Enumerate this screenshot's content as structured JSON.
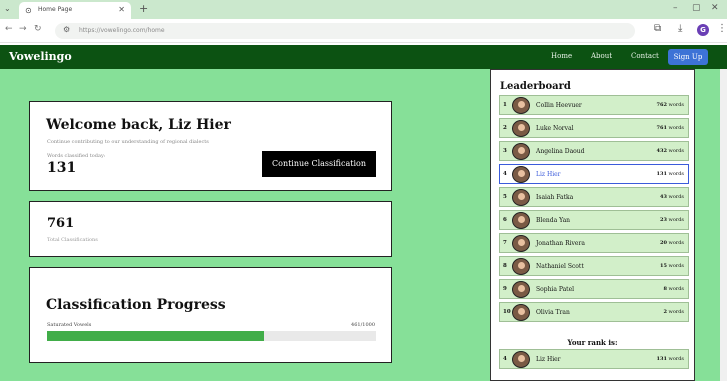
{
  "browser": {
    "tab_title": "Home Page",
    "url": "https://vowelingo.com/home",
    "profile_initial": "G"
  },
  "navbar": {
    "brand": "Vowelingo",
    "links": [
      "Home",
      "About",
      "Contact"
    ],
    "signup": "Sign Up"
  },
  "welcome": {
    "title": "Welcome back, Liz Hier",
    "subtitle": "Continue contributing to our understanding of regional dialects",
    "words_label": "Words classified today:",
    "words_value": "131",
    "continue_button": "Continue Classification"
  },
  "total": {
    "value": "761",
    "label": "Total Classifications"
  },
  "progress": {
    "title": "Classification Progress",
    "label": "Saturated Vowels",
    "count": "461/1000",
    "fraction": 0.66
  },
  "leaderboard": {
    "title": "Leaderboard",
    "rows": [
      {
        "rank": "1",
        "name": "Collin Heevuer",
        "words": "762",
        "unit": "words"
      },
      {
        "rank": "2",
        "name": "Luke Norval",
        "words": "761",
        "unit": "words"
      },
      {
        "rank": "3",
        "name": "Angelina Daoud",
        "words": "432",
        "unit": "words"
      },
      {
        "rank": "4",
        "name": "Liz Hier",
        "words": "131",
        "unit": "words"
      },
      {
        "rank": "5",
        "name": "Isaiah Fatka",
        "words": "43",
        "unit": "words"
      },
      {
        "rank": "6",
        "name": "Blenda Yan",
        "words": "23",
        "unit": "words"
      },
      {
        "rank": "7",
        "name": "Jonathan Rivera",
        "words": "20",
        "unit": "words"
      },
      {
        "rank": "8",
        "name": "Nathaniel Scott",
        "words": "15",
        "unit": "words"
      },
      {
        "rank": "9",
        "name": "Sophia Patel",
        "words": "8",
        "unit": "words"
      },
      {
        "rank": "10",
        "name": "Olivia Tran",
        "words": "2",
        "unit": "words"
      }
    ],
    "your_rank_label": "Your rank is:",
    "your_rank": {
      "rank": "4",
      "name": "Liz Hier",
      "words": "131",
      "unit": "words"
    }
  },
  "colors": {
    "navbar": "#0c5212",
    "page_bg": "#86e098",
    "signup": "#3d73d6",
    "progress_fill": "#41ad49",
    "row_bg": "#d2efc9",
    "current_row_border": "#3b5bdb"
  }
}
